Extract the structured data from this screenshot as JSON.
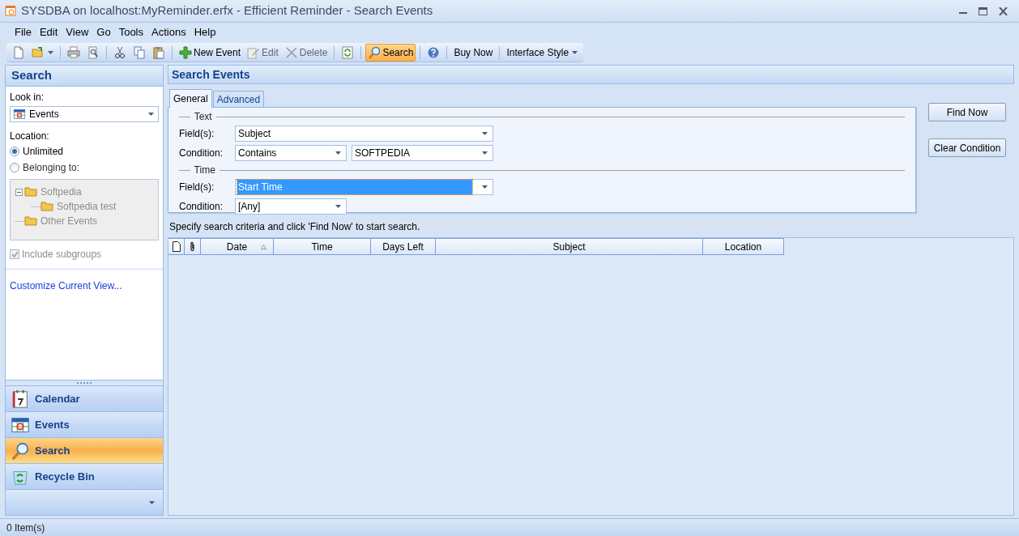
{
  "window": {
    "title": "SYSDBA on localhost:MyReminder.erfx - Efficient Reminder - Search Events"
  },
  "menu": [
    "File",
    "Edit",
    "View",
    "Go",
    "Tools",
    "Actions",
    "Help"
  ],
  "toolbar": [
    {
      "kind": "new",
      "selected": false
    },
    {
      "kind": "open",
      "selected": false
    },
    {
      "kind": "separator"
    },
    {
      "kind": "print",
      "selected": false
    },
    {
      "kind": "preview",
      "selected": false
    },
    {
      "kind": "separator"
    },
    {
      "kind": "cut",
      "selected": false
    },
    {
      "kind": "copy",
      "selected": false
    },
    {
      "kind": "paste",
      "selected": false
    },
    {
      "kind": "separator"
    },
    {
      "kind": "add",
      "label": "New Event",
      "disabled": false,
      "selected": false
    },
    {
      "kind": "edit",
      "label": "Edit",
      "disabled": true,
      "selected": false
    },
    {
      "kind": "delete",
      "label": "Delete",
      "disabled": true,
      "selected": false
    },
    {
      "kind": "separator"
    },
    {
      "kind": "refresh",
      "selected": false
    },
    {
      "kind": "separator"
    },
    {
      "kind": "search",
      "label": "Search",
      "disabled": false,
      "selected": true
    },
    {
      "kind": "separator"
    },
    {
      "kind": "help",
      "selected": false
    },
    {
      "kind": "separator"
    },
    {
      "kind": "text",
      "label": "Buy Now",
      "disabled": false,
      "selected": false
    },
    {
      "kind": "separator"
    },
    {
      "kind": "menu",
      "label": "Interface Style",
      "disabled": false,
      "selected": false
    }
  ],
  "sidebar": {
    "title": "Search",
    "look_in": {
      "label": "Look in:",
      "value": "Events"
    },
    "location_label": "Location:",
    "radios": [
      {
        "label": "Unlimited",
        "selected": true
      },
      {
        "label": "Belonging to:",
        "selected": false
      }
    ],
    "tree": {
      "disabled": true,
      "items": [
        {
          "label": "Softpedia",
          "expanded": true,
          "children": [
            {
              "label": "Softpedia test"
            }
          ]
        },
        {
          "label": "Other Events"
        }
      ]
    },
    "include_subgroups": {
      "label": "Include subgroups",
      "checked": true,
      "disabled": true
    },
    "link": "Customize Current View...",
    "nav": [
      {
        "kind": "calendar",
        "label": "Calendar",
        "selected": false
      },
      {
        "kind": "events",
        "label": "Events",
        "selected": false
      },
      {
        "kind": "search",
        "label": "Search",
        "selected": true
      },
      {
        "kind": "recycle",
        "label": "Recycle Bin",
        "selected": false
      }
    ]
  },
  "main": {
    "title": "Search Events",
    "tabs": [
      {
        "label": "General",
        "selected": true
      },
      {
        "label": "Advanced",
        "selected": false
      }
    ],
    "groups": [
      {
        "title": "Text",
        "field_label": "Field(s):",
        "field": "Subject",
        "field_focused": false,
        "condition_label": "Condition:",
        "condition": "Contains",
        "value": "SOFTPEDIA"
      },
      {
        "title": "Time",
        "field_label": "Field(s):",
        "field": "Start Time",
        "field_focused": true,
        "condition_label": "Condition:",
        "condition": "[Any]"
      }
    ],
    "buttons": [
      "Find Now",
      "Clear Condition"
    ],
    "hint": "Specify search criteria and click 'Find Now' to start search.",
    "table": {
      "columns": [
        {
          "kind": "document"
        },
        {
          "kind": "attachment"
        },
        {
          "kind": "text",
          "label": "Date",
          "sorted": true
        },
        {
          "kind": "text",
          "label": "Time",
          "sorted": false
        },
        {
          "kind": "text",
          "label": "Days Left",
          "sorted": false
        },
        {
          "kind": "text",
          "label": "Subject",
          "sorted": false
        },
        {
          "kind": "text",
          "label": "Location",
          "sorted": false
        }
      ]
    }
  },
  "status_bar": "0 Item(s)"
}
